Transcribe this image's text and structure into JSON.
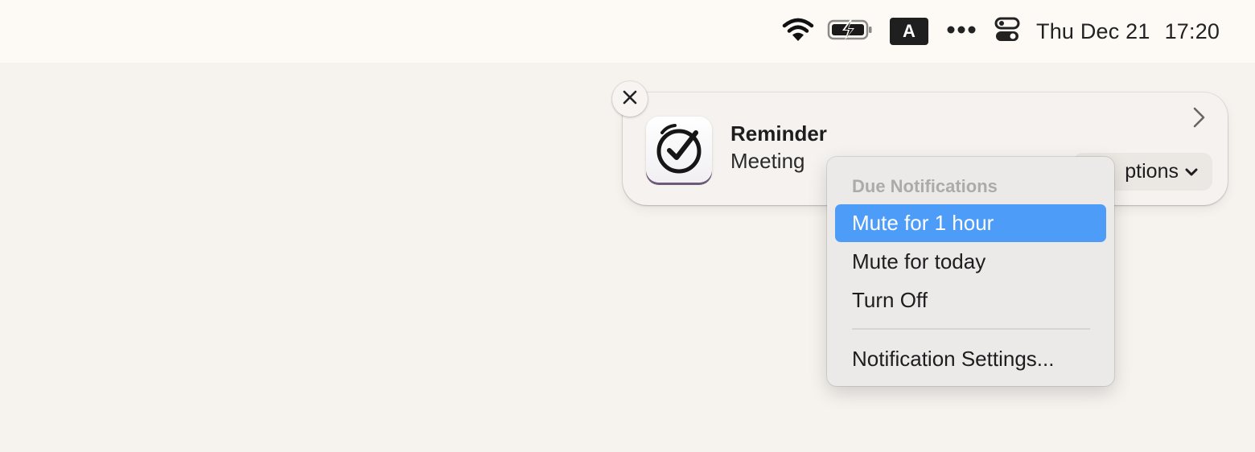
{
  "menubar": {
    "icons": {
      "wifi": "wifi-icon",
      "battery": "battery-charging-icon",
      "input_source": "input-source-icon",
      "more": "more-icon",
      "control_center": "control-center-icon"
    },
    "input_source_label": "A",
    "date": "Thu Dec 21",
    "time": "17:20"
  },
  "notification": {
    "app_icon": "reminder-clock-check-icon",
    "title": "Reminder",
    "body": "Meeting",
    "options_label": "Options",
    "options_visible_label": "ptions",
    "close_icon": "close-icon",
    "expand_icon": "chevron-right-icon"
  },
  "options_menu": {
    "header": "Due Notifications",
    "items": [
      {
        "label": "Mute for 1 hour",
        "selected": true
      },
      {
        "label": "Mute for today",
        "selected": false
      },
      {
        "label": "Turn Off",
        "selected": false
      }
    ],
    "footer_item": "Notification Settings..."
  },
  "colors": {
    "menu_highlight": "#4d9cf8",
    "menubar_bg": "#fdfaf5",
    "desktop_bg": "#f6f2ee"
  }
}
